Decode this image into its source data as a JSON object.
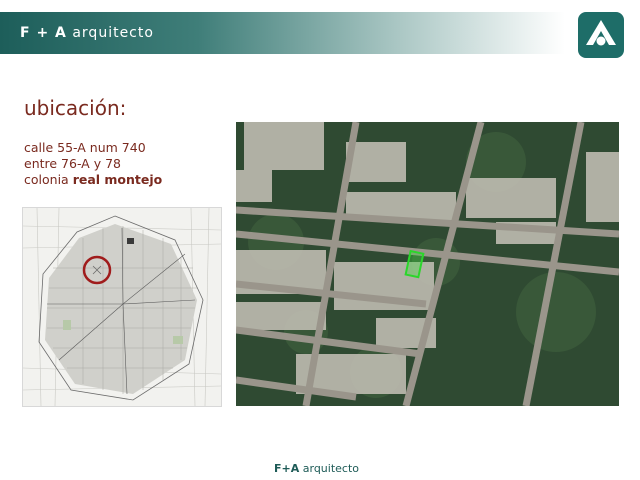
{
  "header": {
    "brand_prefix": "F + A",
    "brand_suffix": "arquitecto"
  },
  "content": {
    "heading": "ubicación:",
    "address_line1": "calle 55-A num 740",
    "address_line2": "entre 76-A y 78",
    "address_colonia_label": "colonia",
    "address_colonia_name": "real montejo"
  },
  "footer": {
    "brand_prefix": "F+A",
    "brand_suffix": "arquitecto"
  },
  "colors": {
    "teal_dark": "#1d5e5a",
    "accent_red": "#7a2a1f",
    "lot_highlight": "#2bd62b"
  }
}
